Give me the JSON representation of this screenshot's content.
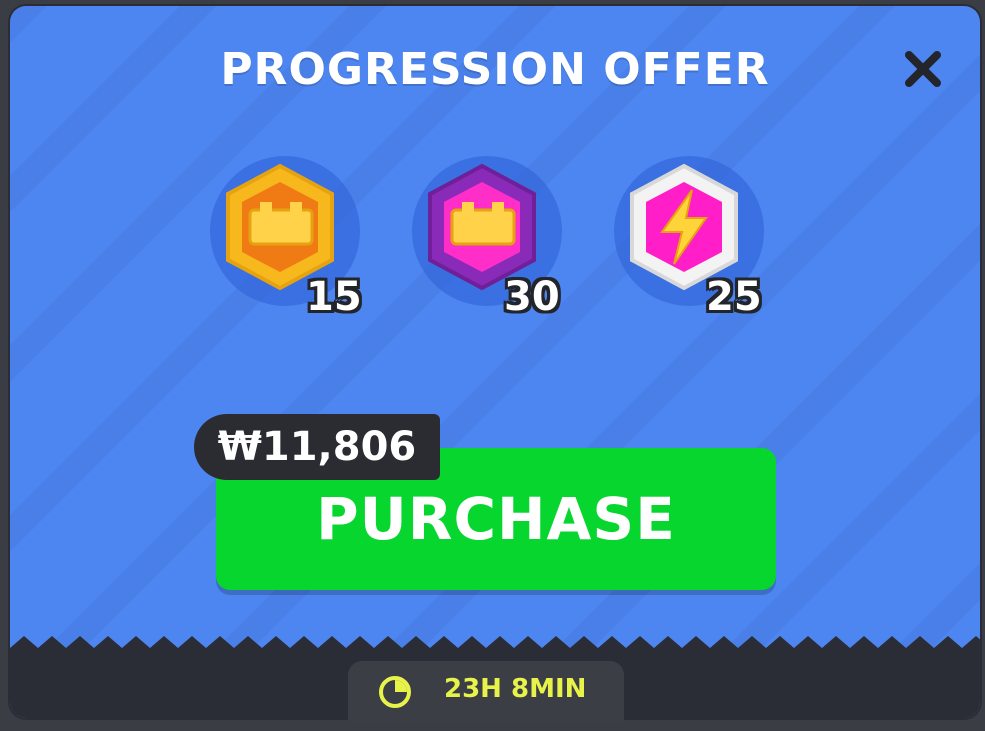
{
  "dialog": {
    "title": "PROGRESSION OFFER",
    "close_icon": "close-icon"
  },
  "rewards": [
    {
      "name": "gold-brick-icon",
      "count": "15",
      "color": "#f6b81c"
    },
    {
      "name": "purple-brick-icon",
      "count": "30",
      "color": "#9b2cc9"
    },
    {
      "name": "lightning-energy-icon",
      "count": "25",
      "color": "#ff1ec8"
    }
  ],
  "offer": {
    "price": "₩11,806",
    "purchase_label": "PURCHASE",
    "button_color": "#07d62e"
  },
  "timer": {
    "icon": "clock-icon",
    "remaining": "23H 8MIN",
    "color": "#e8f34a"
  },
  "background": {
    "panel_color": "#4d86f0"
  }
}
